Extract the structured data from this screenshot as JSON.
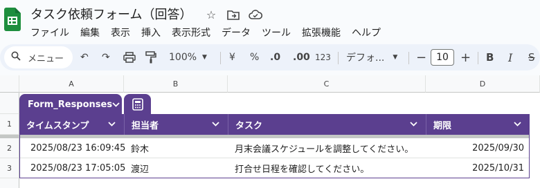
{
  "title_bar": {
    "doc_title": "タスク依頼フォーム（回答）",
    "icons": [
      "star-icon",
      "move-to-folder-icon",
      "cloud-status-icon"
    ]
  },
  "menu": {
    "items": [
      "ファイル",
      "編集",
      "表示",
      "挿入",
      "表示形式",
      "データ",
      "ツール",
      "拡張機能",
      "ヘルプ"
    ]
  },
  "toolbar": {
    "search_label": "メニュー",
    "undo": "↶",
    "redo": "↷",
    "zoom": "100%",
    "currency": "¥",
    "percent": "%",
    "dec_decrease": ".0",
    "dec_increase": ".00",
    "number_format": "123",
    "font_name": "デフォ...",
    "font_size": "10",
    "minus": "−",
    "plus": "+",
    "bold": "B",
    "italic": "I",
    "strike": "S"
  },
  "sheet": {
    "columns": [
      "A",
      "B",
      "C",
      "D"
    ],
    "rows": [
      "1",
      "2",
      "3"
    ],
    "table_name": "Form_Responses",
    "headers": [
      "タイムスタンプ",
      "担当者",
      "タスク",
      "期限"
    ],
    "data": [
      [
        "2025/08/23 16:09:45",
        "鈴木",
        "月末会議スケジュールを調整してください。",
        "2025/09/30"
      ],
      [
        "2025/08/23 17:05:05",
        "渡辺",
        "打合せ日程を確認してください。",
        "2025/10/31"
      ]
    ]
  },
  "colors": {
    "accent": "#5b3f8f",
    "logo": "#1e8e3e"
  }
}
